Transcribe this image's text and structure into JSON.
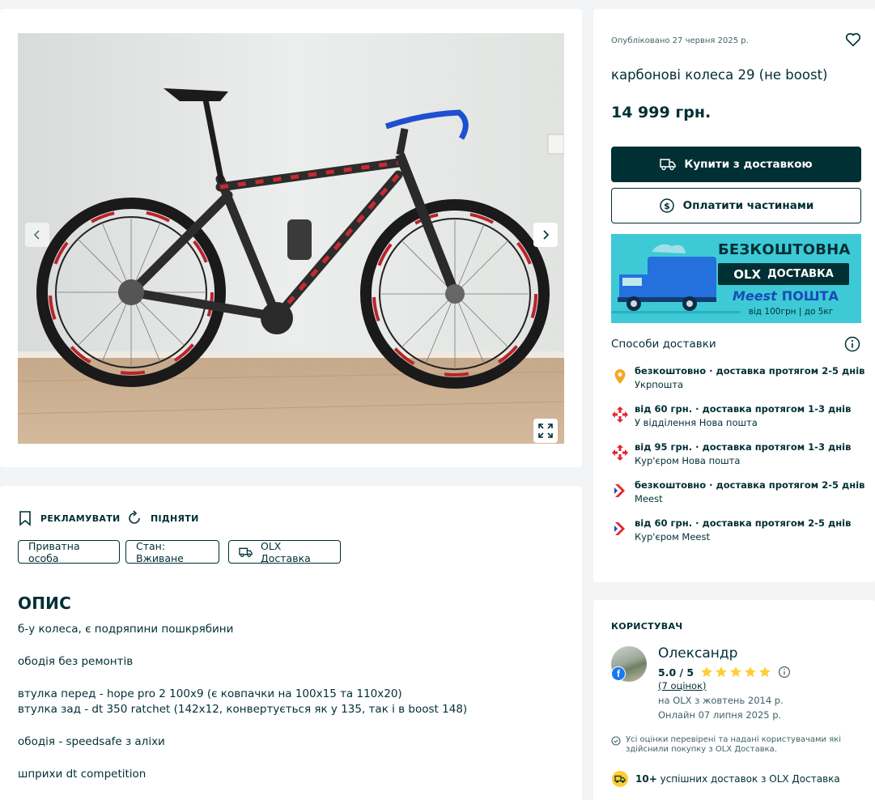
{
  "gallery": {
    "photo_alt": "",
    "prev_icon": "chevron-left-icon",
    "next_icon": "chevron-right-icon",
    "fullscreen_icon": "expand-icon"
  },
  "actions": {
    "promote_label": "РЕКЛАМУВАТИ",
    "raise_label": "ПІДНЯТИ"
  },
  "tags": {
    "seller": "Приватна особа",
    "condition": "Стан: Вживане",
    "delivery": "OLX Доставка"
  },
  "description": {
    "title": "ОПИС",
    "paragraphs": [
      "б-у колеса, є подряпини пошкрябини",
      "ободія без ремонтів",
      "втулка перед - hope pro 2 100x9 (є ковпачки на 100x15 та 110x20)\nвтулка зад - dt 350 ratchet (142x12, конвертується як у 135, так і в boost 148)",
      "ободія - speedsafe з аліхи",
      "шприхи dt competition"
    ]
  },
  "offer": {
    "published": "Опубліковано 27 червня 2025 р.",
    "title": "карбонові колеса 29 (не boost)",
    "price": "14 999 грн.",
    "buy_label": "Купити з доставкою",
    "parts_label": "Оплатити частинами",
    "banner": {
      "line1": "БЕЗКОШТОВНА",
      "olx": "OLX",
      "delivery": "ДОСТАВКА",
      "meest": "Meest",
      "post": "ПОШТА",
      "terms": "від 100грн | до 5кг"
    },
    "delivery_heading": "Способи доставки",
    "delivery_options": [
      {
        "icon": "location-pin-icon",
        "main": "безкоштовно · доставка протягом 2-5 днів",
        "sub": "Укрпошта",
        "color": "#f5a623"
      },
      {
        "icon": "nova-poshta-icon",
        "main": "від 60 грн. · доставка протягом 1-3 днів",
        "sub": "У відділення Нова пошта",
        "color": "#e3262d"
      },
      {
        "icon": "nova-poshta-icon",
        "main": "від 95 грн. · доставка протягом 1-3 днів",
        "sub": "Кур'єром Нова пошта",
        "color": "#e3262d"
      },
      {
        "icon": "meest-icon",
        "main": "безкоштовно · доставка протягом 2-5 днів",
        "sub": "Meest",
        "color": "#e3262d"
      },
      {
        "icon": "meest-icon",
        "main": "від 60 грн. · доставка протягом 2-5 днів",
        "sub": "Кур'єром Meest",
        "color": "#e3262d"
      }
    ]
  },
  "user": {
    "heading": "КОРИСТУВАЧ",
    "name": "Олександр",
    "rating": "5.0 / 5",
    "stars": 5,
    "rating_count": "(7 оцінок)",
    "member_since": "на OLX з жовтень 2014 р.",
    "last_online": "Онлайн 07 липня 2025 р.",
    "verified_note": "Усі оцінки перевірені та надані користувачами які здійснили покупку з OLX Доставка.",
    "deliveries_count": "10+",
    "deliveries_text": "успішних доставок з OLX Доставка"
  },
  "colors": {
    "primary": "#002f34",
    "star": "#ffce32",
    "banner_bg": "#3ec9d6",
    "truck": "#1e6fd9"
  }
}
